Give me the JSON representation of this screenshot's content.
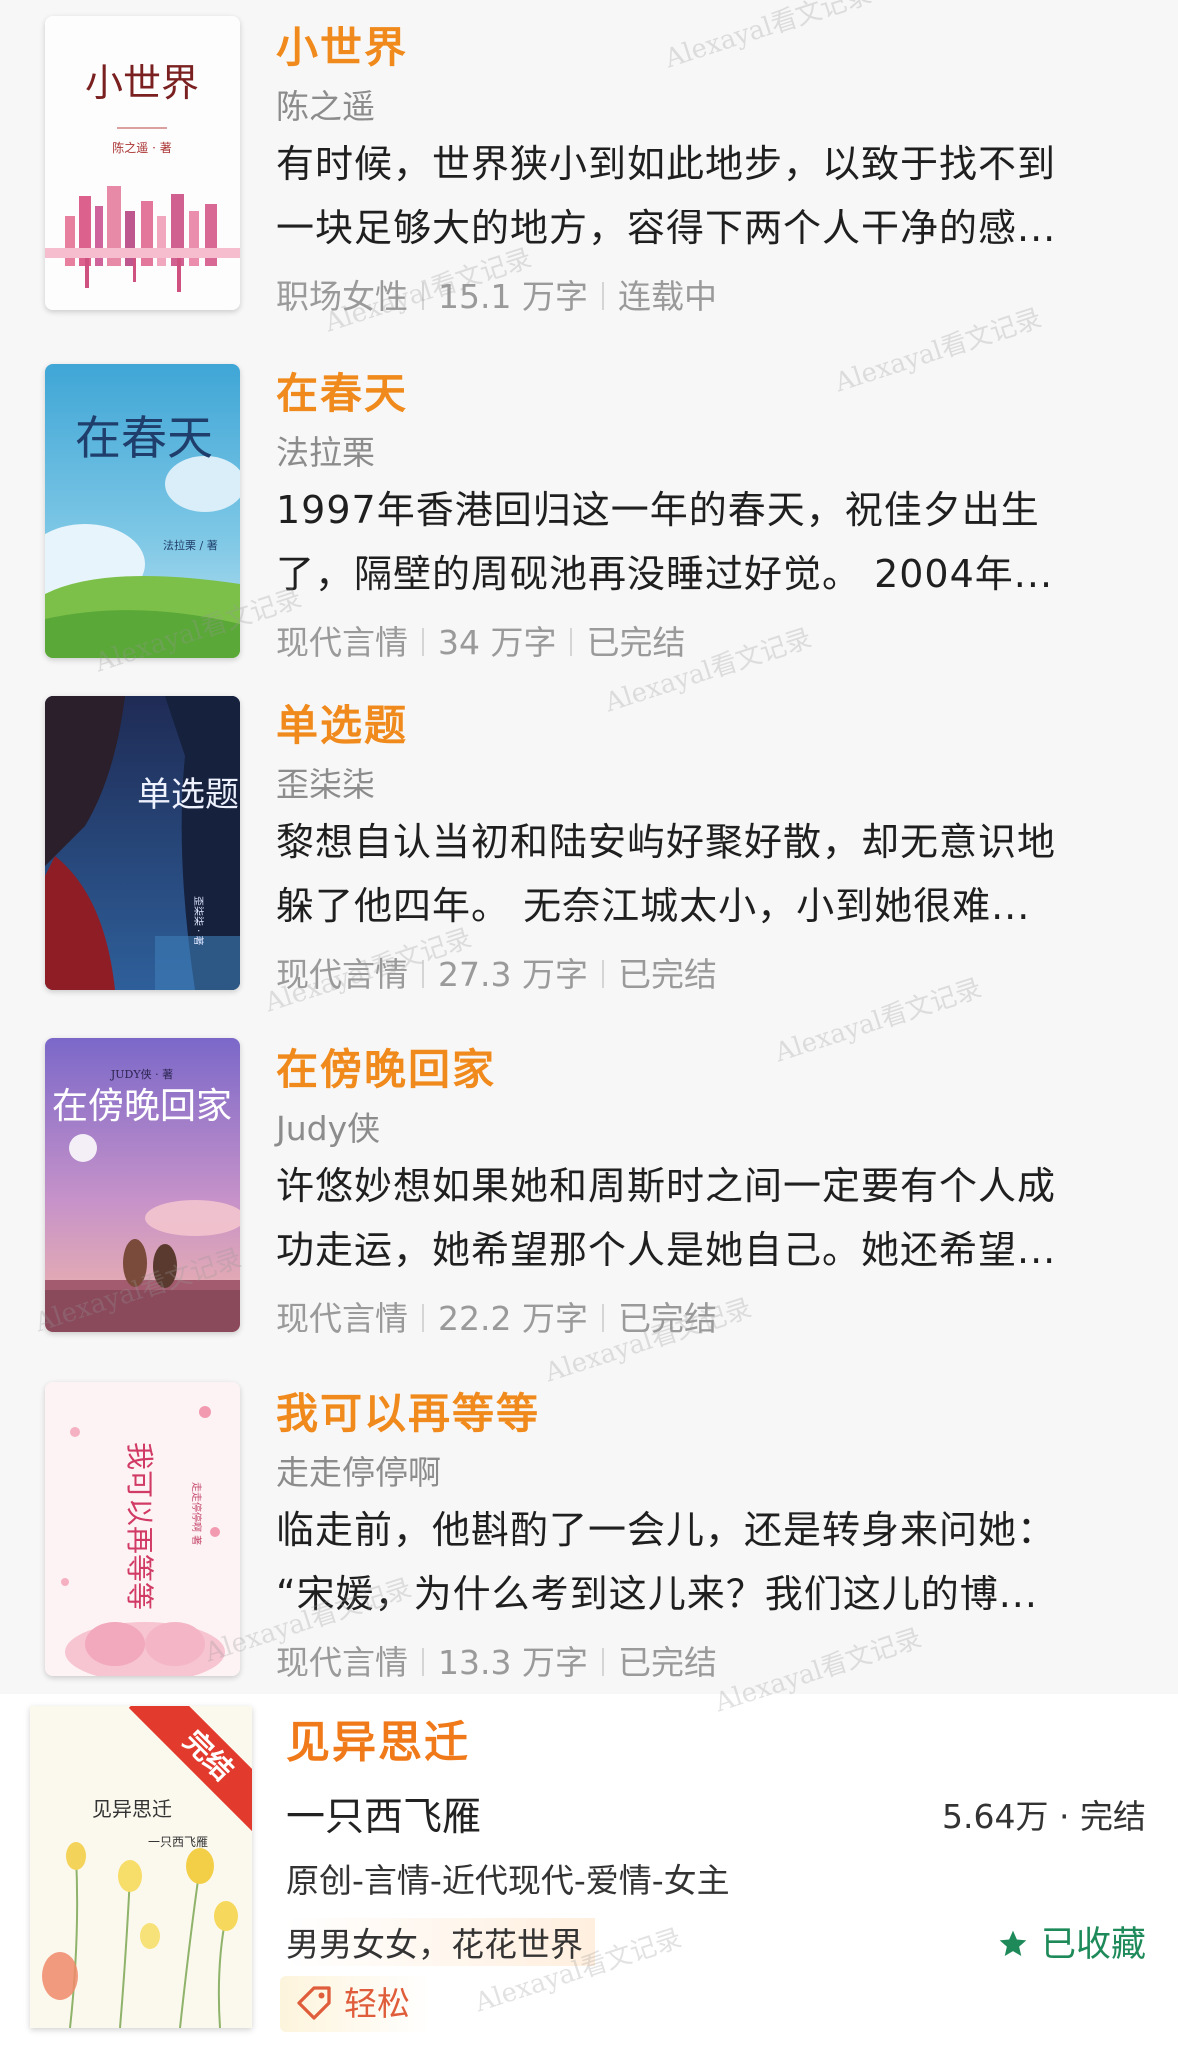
{
  "books": [
    {
      "title": "小世界",
      "author": "陈之遥",
      "desc_line1": "有时候，世界狭小到如此地步，以致于找不到",
      "desc_line2": "一块足够大的地方，容得下两个人干净的感...",
      "category": "职场女性",
      "words": "15.1 万字",
      "status": "连载中",
      "cover_title": "小世界",
      "cover_author": "陈之遥 · 著"
    },
    {
      "title": "在春天",
      "author": "法拉栗",
      "desc_line1": "1997年香港回归这一年的春天，祝佳夕出生",
      "desc_line2": "了，隔壁的周砚池再没睡过好觉。 2004年...",
      "category": "现代言情",
      "words": "34 万字",
      "status": "已完结",
      "cover_title": "在春天",
      "cover_author": "法拉栗 / 著"
    },
    {
      "title": "单选题",
      "author": "歪柒柒",
      "desc_line1": "黎想自认当初和陆安屿好聚好散，却无意识地",
      "desc_line2": "躲了他四年。 无奈江城太小，小到她很难...",
      "category": "现代言情",
      "words": "27.3 万字",
      "status": "已完结",
      "cover_title": "单选题",
      "cover_author": "歪柒柒 · 著"
    },
    {
      "title": "在傍晚回家",
      "author": "Judy侠",
      "desc_line1": "许悠妙想如果她和周斯时之间一定要有个人成",
      "desc_line2": "功走运，她希望那个人是她自己。她还希望...",
      "category": "现代言情",
      "words": "22.2 万字",
      "status": "已完结",
      "cover_title": "在傍晚回家",
      "cover_author": "JUDY侠 · 著"
    },
    {
      "title": "我可以再等等",
      "author": "走走停停啊",
      "desc_line1": "临走前，他斟酌了一会儿，还是转身来问她：",
      "desc_line2": "“宋媛，为什么考到这儿来？我们这儿的博...",
      "category": "现代言情",
      "words": "13.3 万字",
      "status": "已完结",
      "cover_title": "我可以再等等",
      "cover_author": "走走停停啊 著"
    }
  ],
  "last": {
    "title": "见异思迁",
    "author": "一只西飞雁",
    "stat": "5.64万 · 完结",
    "genre": "原创-言情-近代现代-爱情-女主",
    "tagline": "男男女女，花花世界",
    "favorite": "已收藏",
    "tag": "轻松",
    "ribbon": "完结",
    "cover_title": "见异思迁",
    "cover_author": "一只西飞雁"
  },
  "watermark": "Alexayal看文记录",
  "colors": {
    "title": "#f08a1c",
    "accent_green": "#1e8a5a",
    "ribbon": "#e23b2e"
  },
  "icons": [
    "star-icon",
    "tag-icon"
  ]
}
